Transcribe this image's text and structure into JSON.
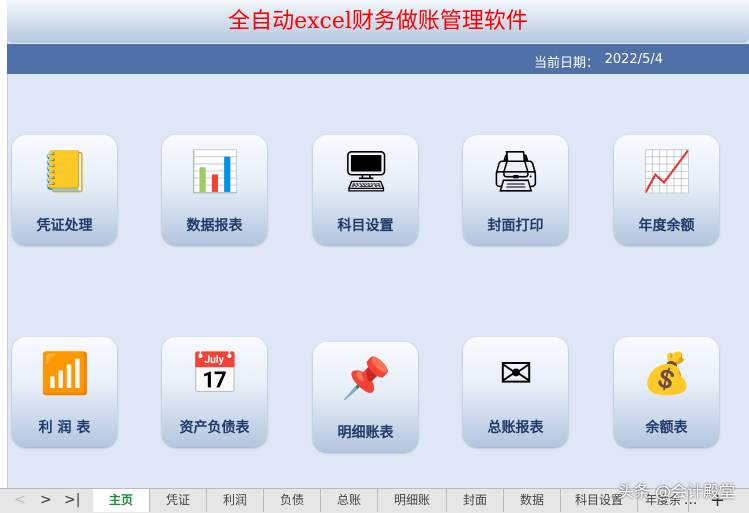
{
  "header": {
    "title": "全自动excel财务做账管理软件",
    "date_label": "当前日期：",
    "date_value": "2022/5/4"
  },
  "tiles": [
    {
      "label": "凭证处理",
      "icon": "voucher-book-icon",
      "glyph": "📒"
    },
    {
      "label": "数据报表",
      "icon": "bar-chart-icon",
      "glyph": "📊"
    },
    {
      "label": "科目设置",
      "icon": "settings-devices-icon",
      "glyph": "🖥"
    },
    {
      "label": "封面打印",
      "icon": "printer-icon",
      "glyph": "🖨"
    },
    {
      "label": "年度余额",
      "icon": "presentation-chart-icon",
      "glyph": "📈"
    },
    {
      "label": "利 润 表",
      "icon": "3d-bar-chart-icon",
      "glyph": "📶"
    },
    {
      "label": "资产负债表",
      "icon": "calendar-icon",
      "glyph": "📅"
    },
    {
      "label": "明细账表",
      "icon": "sticky-note-pin-icon",
      "glyph": "📌"
    },
    {
      "label": "总账报表",
      "icon": "email-icon",
      "glyph": "✉"
    },
    {
      "label": "余额表",
      "icon": "money-bag-icon",
      "glyph": "💰"
    }
  ],
  "sheet_tabs": [
    "主页",
    "凭证",
    "利润",
    "负债",
    "总账",
    "明细账",
    "封面",
    "数据",
    "科目设置",
    "年度余"
  ],
  "nav": {
    "prev": "<",
    "next": ">",
    "last": ">|",
    "more": "...",
    "add": "+"
  },
  "watermark": "头条 @会计殿堂"
}
